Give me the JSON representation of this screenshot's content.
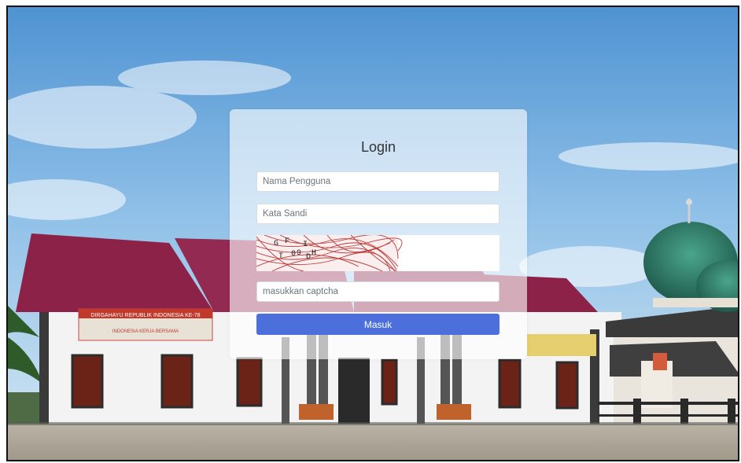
{
  "login": {
    "title": "Login",
    "username_placeholder": "Nama Pengguna",
    "password_placeholder": "Kata Sandi",
    "captcha_placeholder": "masukkan captcha",
    "submit_label": "Masuk"
  },
  "captcha_image": {
    "characters": [
      "G",
      "F",
      "I",
      "T",
      "0",
      "9",
      "D",
      "H"
    ],
    "ink_color": "#b01818"
  },
  "background": {
    "banner_text": "DIRGAHAYU REPUBLIK INDONESIA KE-78",
    "banner_subtext": "INDONESIA KERJA BERSAMA",
    "sky_color": "#8fc0e8",
    "roof_color": "#8c2248",
    "mosque_dome_color": "#2f7a6a",
    "button_color": "#4c6fdb"
  }
}
